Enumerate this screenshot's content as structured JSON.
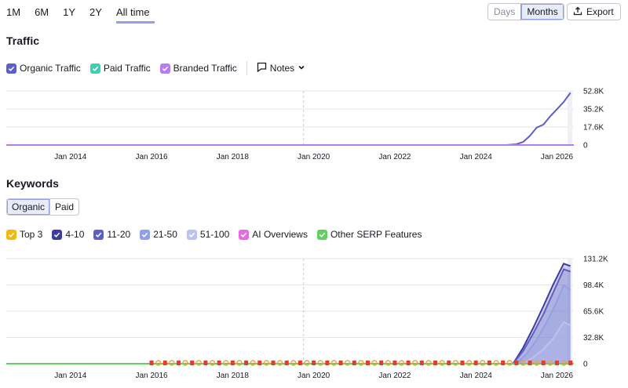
{
  "range_tabs": [
    "1M",
    "6M",
    "1Y",
    "2Y",
    "All time"
  ],
  "active_range": "All time",
  "granularity": {
    "days": "Days",
    "months": "Months"
  },
  "export_label": "Export",
  "traffic": {
    "title": "Traffic",
    "legend": [
      {
        "label": "Organic Traffic",
        "color": "#5b5fc7"
      },
      {
        "label": "Paid Traffic",
        "color": "#3ccfb0"
      },
      {
        "label": "Branded Traffic",
        "color": "#b77cf0"
      }
    ],
    "notes_label": "Notes"
  },
  "keywords": {
    "title": "Keywords",
    "tabs": [
      "Organic",
      "Paid"
    ],
    "legend": [
      {
        "label": "Top 3",
        "color": "#f2b80c"
      },
      {
        "label": "4-10",
        "color": "#3b3d9e"
      },
      {
        "label": "11-20",
        "color": "#5b5fc7"
      },
      {
        "label": "21-50",
        "color": "#8fa0e8"
      },
      {
        "label": "51-100",
        "color": "#b9c4f2"
      },
      {
        "label": "AI Overviews",
        "color": "#e46ce0"
      },
      {
        "label": "Other SERP Features",
        "color": "#5fd05f"
      }
    ]
  },
  "chart_data": [
    {
      "type": "line",
      "title": "Traffic",
      "x_ticks": [
        "Jan 2014",
        "Jan 2016",
        "Jan 2018",
        "Jan 2020",
        "Jan 2022",
        "Jan 2024",
        "Jan 2026"
      ],
      "y_ticks": [
        "52.8K",
        "35.2K",
        "17.6K",
        "0"
      ],
      "ylim": [
        0,
        52800
      ],
      "x_range": [
        "2012-06",
        "2026-06"
      ],
      "series": [
        {
          "name": "Organic Traffic",
          "points": [
            [
              "2012-06",
              0
            ],
            [
              "2024-10",
              0
            ],
            [
              "2025-01",
              800
            ],
            [
              "2025-03",
              3000
            ],
            [
              "2025-05",
              9000
            ],
            [
              "2025-07",
              17000
            ],
            [
              "2025-09",
              20000
            ],
            [
              "2025-11",
              28000
            ],
            [
              "2026-01",
              35000
            ],
            [
              "2026-03",
              42000
            ],
            [
              "2026-05",
              51000
            ]
          ]
        },
        {
          "name": "Branded Traffic",
          "points": [
            [
              "2012-06",
              0
            ],
            [
              "2026-06",
              0
            ]
          ]
        }
      ]
    },
    {
      "type": "area",
      "title": "Keywords",
      "x_ticks": [
        "Jan 2014",
        "Jan 2016",
        "Jan 2018",
        "Jan 2020",
        "Jan 2022",
        "Jan 2024",
        "Jan 2026"
      ],
      "y_ticks": [
        "131.2K",
        "98.4K",
        "65.6K",
        "32.8K",
        "0"
      ],
      "ylim": [
        0,
        131200
      ],
      "x_range": [
        "2012-06",
        "2026-06"
      ],
      "series": [
        {
          "name": "4-10",
          "points": [
            [
              "2012-06",
              0
            ],
            [
              "2024-12",
              0
            ],
            [
              "2025-03",
              20000
            ],
            [
              "2025-06",
              45000
            ],
            [
              "2025-09",
              72000
            ],
            [
              "2025-12",
              100000
            ],
            [
              "2026-03",
              125000
            ],
            [
              "2026-05",
              122000
            ]
          ]
        },
        {
          "name": "11-20",
          "points": [
            [
              "2012-06",
              0
            ],
            [
              "2024-12",
              0
            ],
            [
              "2025-03",
              16000
            ],
            [
              "2025-06",
              38000
            ],
            [
              "2025-09",
              62000
            ],
            [
              "2025-12",
              90000
            ],
            [
              "2026-03",
              118000
            ],
            [
              "2026-05",
              115000
            ]
          ]
        },
        {
          "name": "21-50",
          "points": [
            [
              "2012-06",
              0
            ],
            [
              "2025-01",
              0
            ],
            [
              "2025-04",
              12000
            ],
            [
              "2025-07",
              30000
            ],
            [
              "2025-10",
              52000
            ],
            [
              "2026-01",
              78000
            ],
            [
              "2026-03",
              98000
            ],
            [
              "2026-05",
              92000
            ]
          ]
        },
        {
          "name": "51-100",
          "points": [
            [
              "2012-06",
              0
            ],
            [
              "2025-03",
              0
            ],
            [
              "2025-06",
              8000
            ],
            [
              "2025-09",
              18000
            ],
            [
              "2025-12",
              32000
            ],
            [
              "2026-03",
              52000
            ],
            [
              "2026-05",
              48000
            ]
          ]
        },
        {
          "name": "Other SERP Features",
          "points": [
            [
              "2012-06",
              0
            ],
            [
              "2026-06",
              0
            ]
          ]
        }
      ]
    }
  ]
}
